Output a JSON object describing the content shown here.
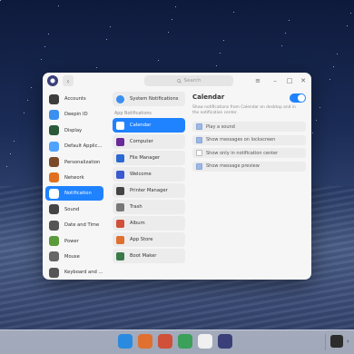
{
  "window": {
    "search_placeholder": "Search"
  },
  "sidebar": {
    "items": [
      {
        "label": "Accounts",
        "icon": "accounts-icon",
        "color": "#3d3d3d"
      },
      {
        "label": "Deepin ID",
        "icon": "cloud-icon",
        "color": "#3a8ff0"
      },
      {
        "label": "Display",
        "icon": "display-icon",
        "color": "#2a5a3a"
      },
      {
        "label": "Default Applic...",
        "icon": "default-apps-icon",
        "color": "#4fa3ff"
      },
      {
        "label": "Personalization",
        "icon": "personalization-icon",
        "color": "#7a4a2a"
      },
      {
        "label": "Network",
        "icon": "network-icon",
        "color": "#e07020"
      },
      {
        "label": "Notification",
        "icon": "notification-icon",
        "color": "#ffffff",
        "active": true
      },
      {
        "label": "Sound",
        "icon": "sound-icon",
        "color": "#444444"
      },
      {
        "label": "Date and Time",
        "icon": "clock-icon",
        "color": "#555555"
      },
      {
        "label": "Power",
        "icon": "power-icon",
        "color": "#5a9a3a"
      },
      {
        "label": "Mouse",
        "icon": "mouse-icon",
        "color": "#666666"
      },
      {
        "label": "Keyboard and ...",
        "icon": "keyboard-icon",
        "color": "#555555"
      }
    ]
  },
  "middle": {
    "system_notifications_label": "System Notifications",
    "section_label": "App Notifications",
    "apps": [
      {
        "label": "Calendar",
        "icon": "calendar-icon",
        "color": "#ffffff",
        "active": true
      },
      {
        "label": "Computer",
        "icon": "computer-icon",
        "color": "#6a2a9a"
      },
      {
        "label": "File Manager",
        "icon": "file-manager-icon",
        "color": "#2a6ad0"
      },
      {
        "label": "Welcome",
        "icon": "welcome-icon",
        "color": "#3a5ad0"
      },
      {
        "label": "Printer Manager",
        "icon": "printer-icon",
        "color": "#444444"
      },
      {
        "label": "Trash",
        "icon": "trash-icon",
        "color": "#777777"
      },
      {
        "label": "Album",
        "icon": "album-icon",
        "color": "#d0503a"
      },
      {
        "label": "App Store",
        "icon": "app-store-icon",
        "color": "#e07030"
      },
      {
        "label": "Boot Maker",
        "icon": "boot-maker-icon",
        "color": "#3a7a4a"
      }
    ]
  },
  "detail": {
    "title": "Calendar",
    "description": "Show notifications from Calendar on desktop and in the notification center.",
    "options": [
      {
        "label": "Play a sound",
        "checked": true
      },
      {
        "label": "Show messages on lockscreen",
        "checked": true
      },
      {
        "label": "Show only in notification center",
        "checked": false
      },
      {
        "label": "Show message preview",
        "checked": true
      }
    ]
  },
  "dock": {
    "apps": [
      {
        "icon": "file-manager-icon",
        "color": "#2a8ae0"
      },
      {
        "icon": "app-store-icon",
        "color": "#e07030"
      },
      {
        "icon": "album-icon",
        "color": "#d0503a"
      },
      {
        "icon": "music-icon",
        "color": "#3aa05a"
      },
      {
        "icon": "calendar-icon",
        "color": "#f0f0f0"
      },
      {
        "icon": "control-center-icon",
        "color": "#3a3f7a"
      }
    ]
  }
}
